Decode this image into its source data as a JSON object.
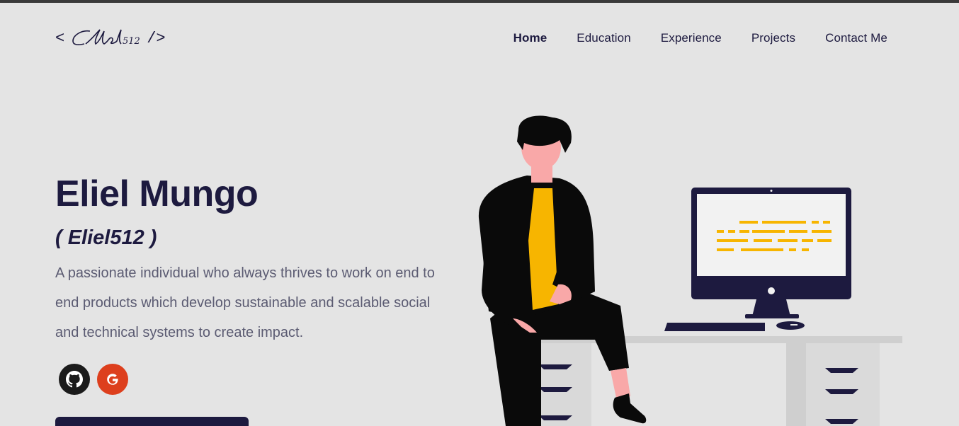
{
  "header": {
    "logo": {
      "open_bracket": "<",
      "signature_text": "Eliel512",
      "close_bracket": "/>"
    },
    "nav": [
      {
        "label": "Home",
        "active": true
      },
      {
        "label": "Education",
        "active": false
      },
      {
        "label": "Experience",
        "active": false
      },
      {
        "label": "Projects",
        "active": false
      },
      {
        "label": "Contact Me",
        "active": false
      }
    ]
  },
  "hero": {
    "name": "Eliel Mungo",
    "handle": "( Eliel512 )",
    "description": "A passionate individual who always thrives to work on end to end products which develop sustainable and scalable social and technical systems to create impact.",
    "socials": [
      {
        "icon": "github-icon",
        "color": "#1b1b1b"
      },
      {
        "icon": "google-icon",
        "color": "#dd3f1d"
      }
    ]
  },
  "colors": {
    "background": "#e4e4e4",
    "primary": "#1d1a3f",
    "text_muted": "#5b5b72",
    "accent_yellow": "#f7b500",
    "skin": "#f9a8a8"
  }
}
